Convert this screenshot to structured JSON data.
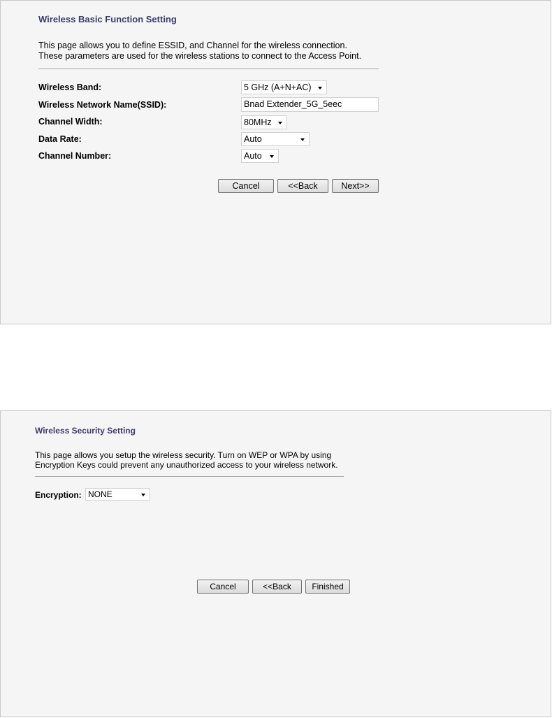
{
  "basic": {
    "title": "Wireless Basic Function Setting",
    "desc1": "This page allows you to define ESSID, and Channel for the wireless connection.",
    "desc2": "These parameters are used for the wireless stations to connect to the Access Point.",
    "band_label": "Wireless Band:",
    "band_value": "5 GHz (A+N+AC)",
    "ssid_label": "Wireless Network Name(SSID):",
    "ssid_value": "Bnad Extender_5G_5eec",
    "width_label": "Channel Width:",
    "width_value": "80MHz",
    "rate_label": "Data Rate:",
    "rate_value": "Auto",
    "channel_label": "Channel Number:",
    "channel_value": "Auto",
    "cancel": "Cancel",
    "back": "<<Back",
    "next": "Next>>"
  },
  "security": {
    "title": "Wireless Security Setting",
    "desc1": "This page allows you setup the wireless security. Turn on WEP or WPA by using",
    "desc2": "Encryption Keys could prevent any unauthorized access to your wireless network.",
    "enc_label": "Encryption:",
    "enc_value": "NONE",
    "cancel": "Cancel",
    "back": "<<Back",
    "finished": "Finished"
  }
}
